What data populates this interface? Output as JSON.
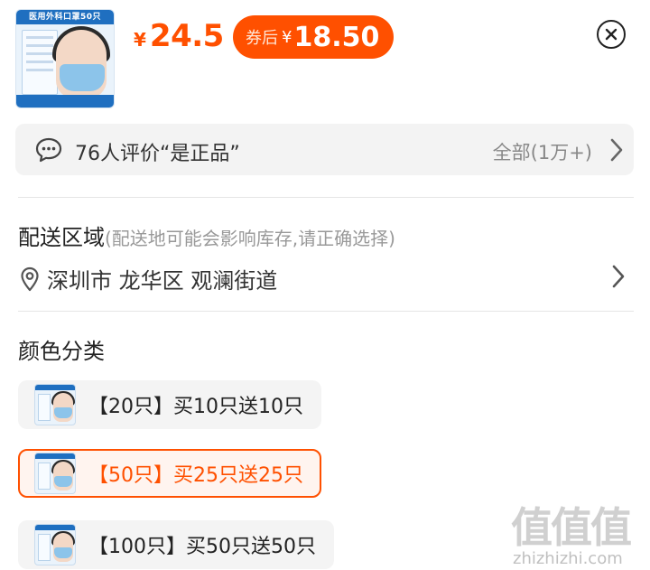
{
  "product": {
    "image_caption": "医用外科口罩50只",
    "price_symbol": "¥",
    "price": "24.5",
    "coupon_label": "券后",
    "coupon_symbol": "¥",
    "coupon_price": "18.50"
  },
  "icons": {
    "close": "close-circle-icon",
    "chat": "chat-bubble-icon",
    "location": "location-pin-icon",
    "chevron": "chevron-right-icon"
  },
  "reviews": {
    "summary": "76人评价“是正品”",
    "all_label": "全部(1万+)"
  },
  "delivery": {
    "title": "配送区域",
    "hint": "(配送地可能会影响库存,请正确选择)",
    "address": "深圳市 龙华区 观澜街道"
  },
  "color_section": {
    "title": "颜色分类",
    "options": [
      {
        "label": "【20只】买10只送10只",
        "selected": false
      },
      {
        "label": "【50只】买25只送25只",
        "selected": true
      },
      {
        "label": "【100只】买50只送50只",
        "selected": false
      }
    ]
  },
  "watermark": {
    "logo_text": "值值值",
    "url": "zhizhizhi.com"
  },
  "colors": {
    "accent": "#ff5000",
    "selected_bg": "#fff4ef",
    "chip_bg": "#f4f4f4"
  }
}
